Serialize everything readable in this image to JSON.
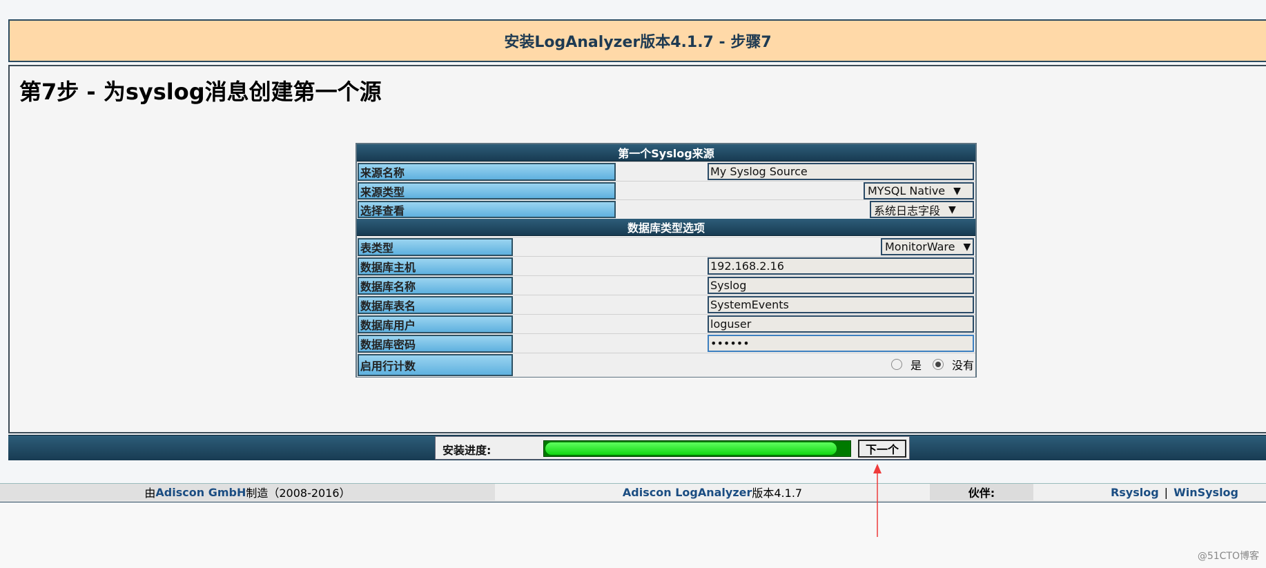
{
  "header": {
    "title": "安装LogAnalyzer版本4.1.7 - 步骤7"
  },
  "step": {
    "title": "第7步 - 为syslog消息创建第一个源"
  },
  "form": {
    "section1": {
      "title": "第一个Syslog来源",
      "rows": [
        {
          "label": "来源名称",
          "value": "My Syslog Source"
        },
        {
          "label": "来源类型",
          "value": "MYSQL Native"
        },
        {
          "label": "选择查看",
          "value": "系统日志字段"
        }
      ]
    },
    "section2": {
      "title": "数据库类型选项",
      "rows": [
        {
          "label": "表类型",
          "value": "MonitorWare"
        },
        {
          "label": "数据库主机",
          "value": "192.168.2.16"
        },
        {
          "label": "数据库名称",
          "value": "Syslog"
        },
        {
          "label": "数据库表名",
          "value": "SystemEvents"
        },
        {
          "label": "数据库用户",
          "value": "loguser"
        },
        {
          "label": "数据库密码",
          "value": "••••••"
        },
        {
          "label": "启用行计数",
          "option_yes": "是",
          "option_no": "没有",
          "selected": "no"
        }
      ]
    }
  },
  "progress": {
    "label": "安装进度:",
    "fraction": 0.95,
    "next_label": "下一个"
  },
  "footer": {
    "made_by_prefix": "由",
    "made_by_link": "Adiscon GmbH",
    "made_by_suffix": "制造（2008-2016）",
    "product_link": "Adiscon LogAnalyzer",
    "product_suffix": "版本4.1.7",
    "partners_label": "伙伴:",
    "partner1": "Rsyslog",
    "separator": "|",
    "partner2": "WinSyslog"
  },
  "watermark": "@51CTO博客",
  "colors": {
    "header_bg": "#ffd9a8",
    "bar_dark": "#183b52",
    "label_blue": "#5fb1df",
    "progress_green": "#11d611"
  }
}
